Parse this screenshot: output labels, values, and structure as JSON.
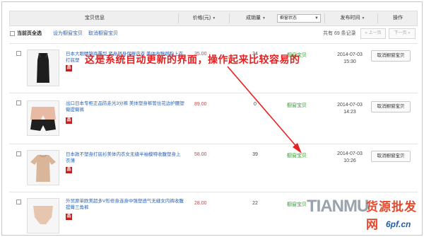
{
  "header": {
    "col_item": "宝贝信息",
    "col_price": "价格(元)",
    "col_sales": "成销量",
    "col_status_select": "橱窗状态",
    "col_time": "发布时间",
    "col_action": "操作"
  },
  "toolbar": {
    "select_all_label": "当前页全选",
    "set_window_link": "设为橱窗宝贝",
    "cancel_window_link": "取消橱窗宝贝",
    "record_count": "共有 69 条记录",
    "prev_label": "« 上一页",
    "next_label": "下一页 »"
  },
  "rows": [
    {
      "title": "日本大眼睛锦商覆型 紧身塑身保暖内衣 美体收腹燃脂上衣打底塑",
      "price": "35.00",
      "sales": "34",
      "status": "橱窗宝贝",
      "date": "2014-07-03",
      "time": "15:30",
      "badge": "品",
      "action": "取消橱窗宝贝"
    },
    {
      "title": "出口日本专柜正品防走光3分裤 美体塑身裤管住花边护腰塑臀提臀裤",
      "price": "89.00",
      "sales": "0",
      "status": "橱窗宝贝",
      "date": "2014-07-03",
      "time": "14:23",
      "badge": "品",
      "action": "取消橱窗宝贝"
    },
    {
      "title": "日本款不塑身打底衫美体内衣女无缝半袖模特收腹塑身上衣薄",
      "price": "58.00",
      "sales": "39",
      "status": "橱窗宝贝",
      "date": "2014-07-03",
      "time": "10:26",
      "badge": "品",
      "action": "取消橱窗宝贝"
    },
    {
      "title": "外贸原单欧美超多V形修身连身中强塑透气无缝女内裤收腹提臀三角裤",
      "price": "28.00",
      "sales": "22",
      "status": "橱窗宝贝",
      "date": "",
      "time": "",
      "badge": "品",
      "action": ""
    }
  ],
  "annotation": {
    "text": "这是系统自动更新的界面，操作起来比较容易的",
    "color": "#e52121"
  },
  "watermark": {
    "text_en": "TIANMU",
    "text_cn": "货源批发网",
    "url": "6pf.cn"
  },
  "colors": {
    "link": "#2b63b8",
    "price": "#d04040",
    "status": "#3a9a3a",
    "badge": "#c81e1e",
    "header_bg": "#efefef"
  }
}
